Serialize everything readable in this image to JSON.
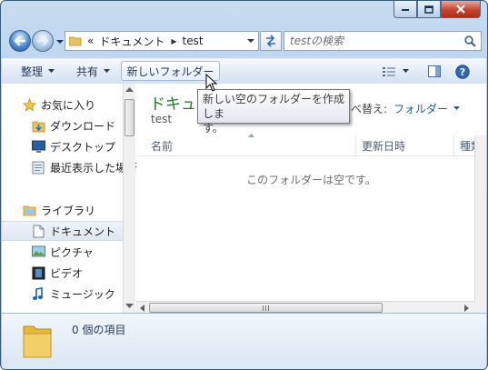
{
  "address": {
    "overflow": "«",
    "crumbs": [
      "ドキュメント",
      "test"
    ],
    "search_placeholder": "testの検索"
  },
  "toolbar": {
    "organize": "整理",
    "share": "共有",
    "new_folder": "新しいフォルダー"
  },
  "navpane": {
    "favorites": "お気に入り",
    "downloads": "ダウンロード",
    "desktop": "デスクトップ",
    "recent": "最近表示した場所",
    "libraries": "ライブラリ",
    "documents": "ドキュメント",
    "pictures": "ピクチャ",
    "videos": "ビデオ",
    "music": "ミュージック"
  },
  "library": {
    "title": "ドキュメ",
    "subtitle": "test",
    "arrange_label": "べ替え:",
    "arrange_value": "フォルダー"
  },
  "columns": {
    "name": "名前",
    "modified": "更新日時",
    "type": "種類"
  },
  "empty_message": "このフォルダーは空です。",
  "tooltip": {
    "line1": "新しい空のフォルダーを作成しま",
    "line2": "す。"
  },
  "details": {
    "item_count": "0 個の項目"
  }
}
